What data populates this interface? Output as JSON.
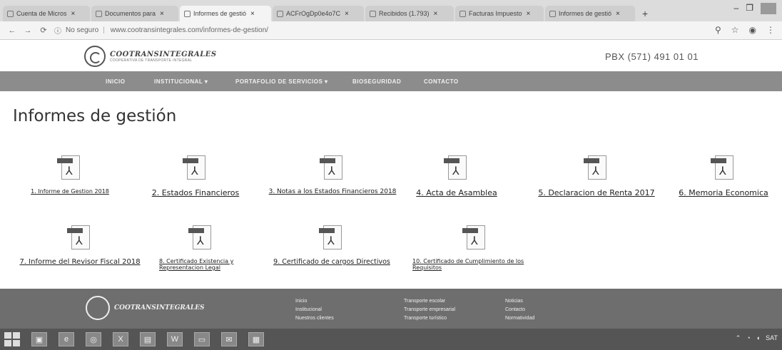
{
  "browser": {
    "tabs": [
      {
        "label": "Cuenta de Micros",
        "active": false
      },
      {
        "label": "Documentos para",
        "active": false
      },
      {
        "label": "Informes de gestió",
        "active": true
      },
      {
        "label": "ACFrOgDp0e4o7C",
        "active": false
      },
      {
        "label": "Recibidos (1.793)",
        "active": false
      },
      {
        "label": "Facturas Impuesto",
        "active": false
      },
      {
        "label": "Informes de gestió",
        "active": false
      }
    ],
    "new_tab": "+",
    "security_label": "No seguro",
    "url": "www.cootransintegrales.com/informes-de-gestion/"
  },
  "site": {
    "brand": "COOTRANSINTEGRALES",
    "brand_sub": "COOPERATIVA DE TRANSPORTE INTEGRAL",
    "pbx": "PBX (571) 491 01 01",
    "nav": [
      "INICIO",
      "INSTITUCIONAL ▾",
      "PORTAFOLIO DE SERVICIOS ▾",
      "BIOSEGURIDAD",
      "CONTACTO"
    ]
  },
  "page": {
    "title": "Informes de gestión",
    "documents": [
      {
        "label": "1. Informe de Gestion 2018"
      },
      {
        "label": "2. Estados Financieros"
      },
      {
        "label": "3. Notas a los Estados Financieros 2018"
      },
      {
        "label": "4. Acta de Asamblea"
      },
      {
        "label": "5. Declaracion de Renta 2017"
      },
      {
        "label": "6. Memoria Economica"
      },
      {
        "label": "7. Informe del Revisor Fiscal 2018"
      },
      {
        "label": "8. Certificado Existencia y Representacion Legal"
      },
      {
        "label": "9. Certificado de cargos Directivos"
      },
      {
        "label": "10. Certificado de Cumplimiento de los Requisitos"
      }
    ]
  },
  "footer": {
    "col1": [
      "Inicio",
      "Institucional",
      "Nuestros clientes"
    ],
    "col2": [
      "Transporte escolar",
      "Transporte empresarial",
      "Transporte turístico"
    ],
    "col3": [
      "Noticias",
      "Contacto",
      "Normatividad"
    ]
  },
  "taskbar": {
    "tray": "SAT"
  }
}
